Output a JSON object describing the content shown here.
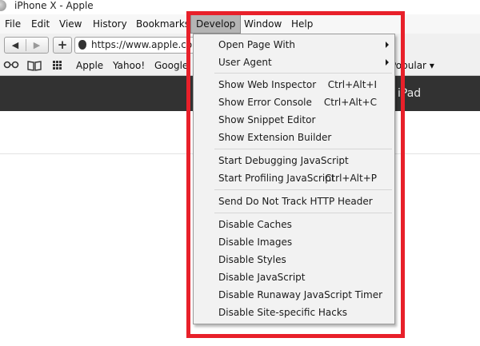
{
  "window": {
    "title": "iPhone X - Apple"
  },
  "menubar": {
    "items": [
      {
        "label": "File"
      },
      {
        "label": "Edit"
      },
      {
        "label": "View"
      },
      {
        "label": "History"
      },
      {
        "label": "Bookmarks"
      },
      {
        "label": "Develop"
      },
      {
        "label": "Window"
      },
      {
        "label": "Help"
      }
    ],
    "active": "Develop"
  },
  "navbar": {
    "back_icon": "back-arrow-icon",
    "forward_icon": "forward-arrow-icon",
    "add_label": "+",
    "url": "https://www.apple.com"
  },
  "bookmarks": {
    "items": [
      {
        "label": "Apple"
      },
      {
        "label": "Yahoo!"
      },
      {
        "label": "Google"
      }
    ],
    "popular_label": "Popular"
  },
  "page": {
    "nav_item": "iPad",
    "nav_color": "#323232"
  },
  "develop_menu": {
    "items": [
      {
        "label": "Open Page With",
        "submenu": true
      },
      {
        "label": "User Agent",
        "submenu": true
      },
      {
        "label": "Show Web Inspector",
        "shortcut": "Ctrl+Alt+I"
      },
      {
        "label": "Show Error Console",
        "shortcut": "Ctrl+Alt+C"
      },
      {
        "label": "Show Snippet Editor"
      },
      {
        "label": "Show Extension Builder"
      },
      {
        "label": "Start Debugging JavaScript"
      },
      {
        "label": "Start Profiling JavaScript",
        "shortcut": "Ctrl+Alt+P"
      },
      {
        "label": "Send Do Not Track HTTP Header"
      },
      {
        "label": "Disable Caches"
      },
      {
        "label": "Disable Images"
      },
      {
        "label": "Disable Styles"
      },
      {
        "label": "Disable JavaScript"
      },
      {
        "label": "Disable Runaway JavaScript Timer"
      },
      {
        "label": "Disable Site-specific Hacks"
      }
    ]
  },
  "annotation": {
    "highlight_color": "#e8202a"
  }
}
